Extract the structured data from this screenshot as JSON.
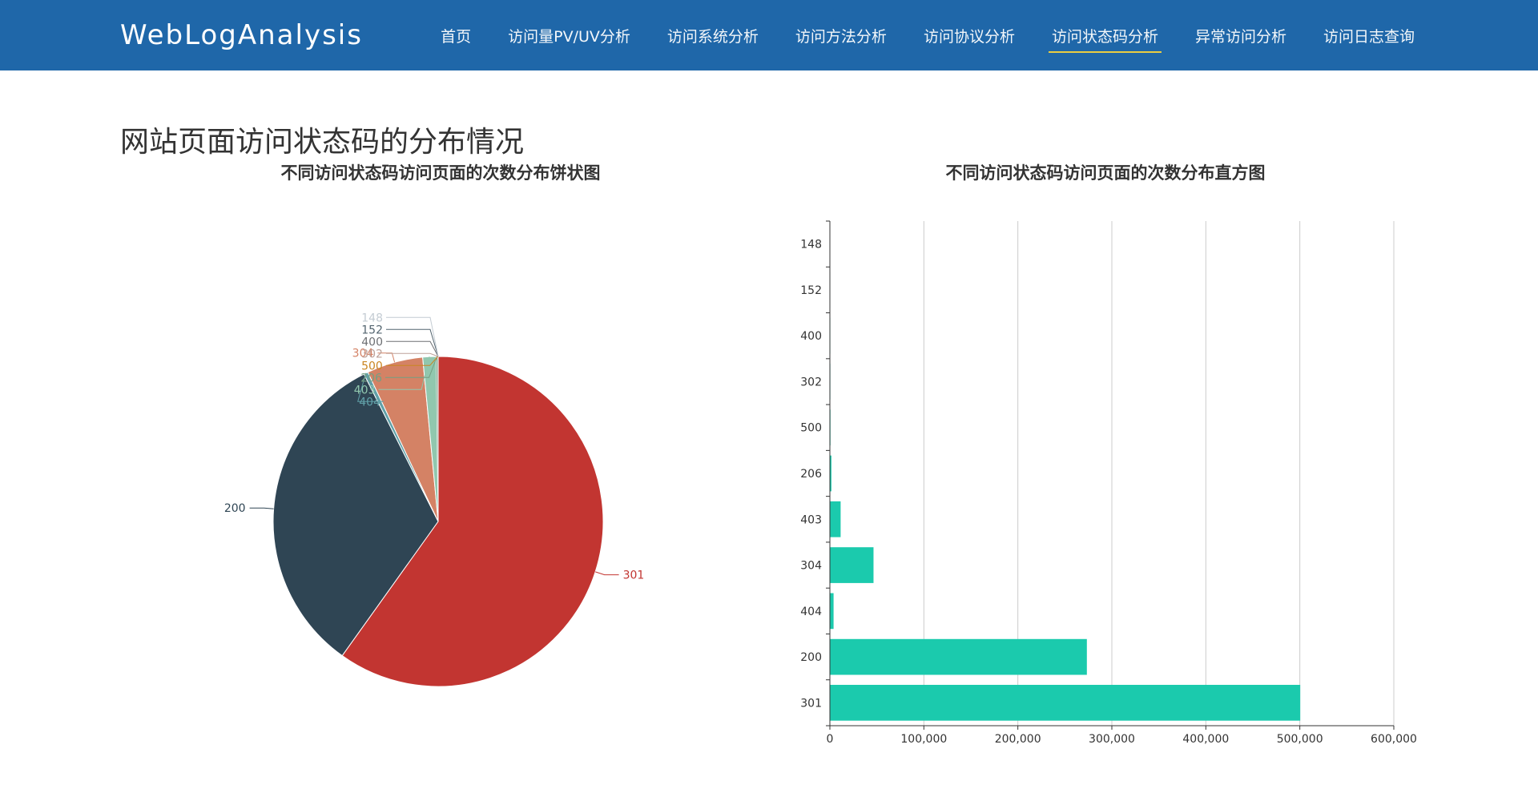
{
  "header": {
    "brand": "WebLogAnalysis",
    "nav": [
      {
        "label": "首页",
        "active": false
      },
      {
        "label": "访问量PV/UV分析",
        "active": false
      },
      {
        "label": "访问系统分析",
        "active": false
      },
      {
        "label": "访问方法分析",
        "active": false
      },
      {
        "label": "访问协议分析",
        "active": false
      },
      {
        "label": "访问状态码分析",
        "active": true
      },
      {
        "label": "异常访问分析",
        "active": false
      },
      {
        "label": "访问日志查询",
        "active": false
      }
    ]
  },
  "page": {
    "heading": "网站页面访问状态码的分布情况"
  },
  "colors": {
    "header_bg": "#1f67a9",
    "bar": "#1bcaad",
    "active_underline": "#f5d33d"
  },
  "chart_data": [
    {
      "type": "pie",
      "title": "不同访问状态码访问页面的次数分布饼状图",
      "categories": [
        "301",
        "200",
        "404",
        "304",
        "403",
        "206",
        "500",
        "302",
        "400",
        "152",
        "148"
      ],
      "values": [
        500000,
        273000,
        3500,
        46000,
        11000,
        1200,
        200,
        80,
        40,
        5,
        2
      ],
      "colors": [
        "#c23531",
        "#2f4554",
        "#61a0a8",
        "#d48265",
        "#91c7ae",
        "#749f83",
        "#ca8622",
        "#bda29a",
        "#6e7074",
        "#546570",
        "#c4ccd3"
      ]
    },
    {
      "type": "bar",
      "orientation": "horizontal",
      "title": "不同访问状态码访问页面的次数分布直方图",
      "categories": [
        "301",
        "200",
        "404",
        "304",
        "403",
        "206",
        "500",
        "302",
        "400",
        "152",
        "148"
      ],
      "values": [
        500000,
        273000,
        3500,
        46000,
        11000,
        1200,
        200,
        80,
        40,
        5,
        2
      ],
      "xlim": [
        0,
        600000
      ],
      "xticks": [
        "0",
        "100,000",
        "200,000",
        "300,000",
        "400,000",
        "500,000",
        "600,000"
      ],
      "grid": true
    }
  ]
}
